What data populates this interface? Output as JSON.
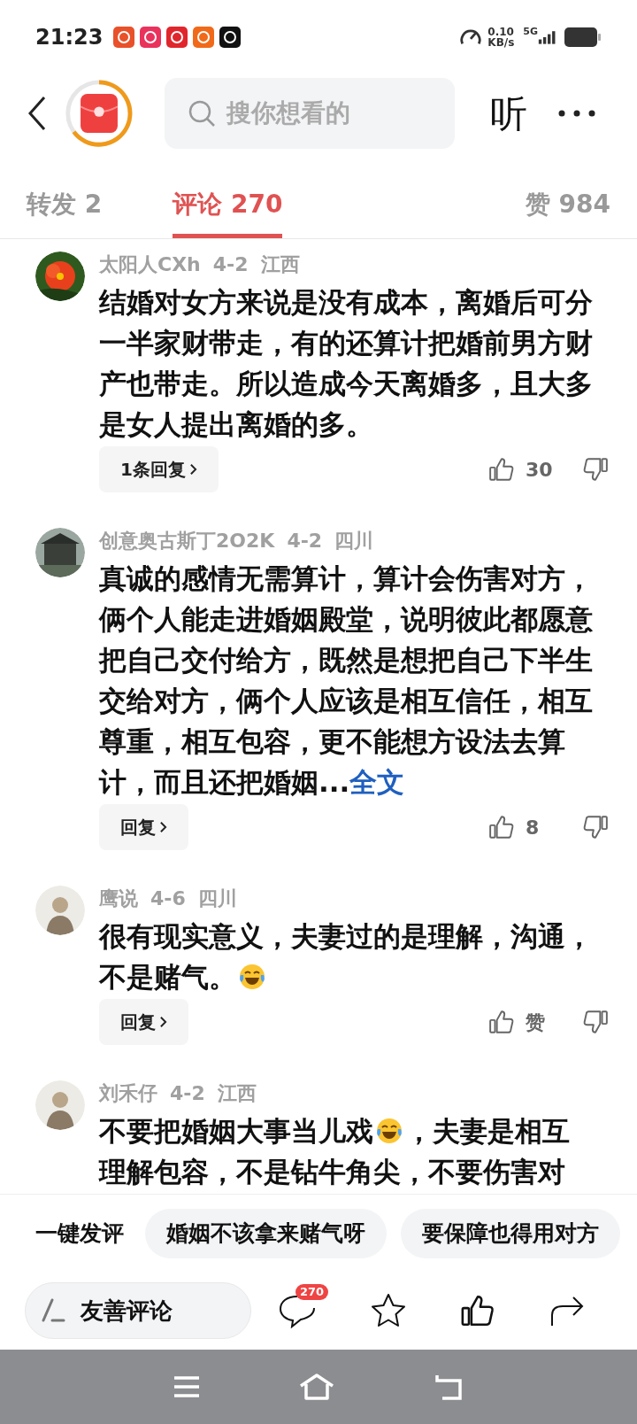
{
  "status_bar": {
    "time": "21:23",
    "speed": "0.10",
    "speed_unit": "KB/s",
    "network": "5G"
  },
  "header": {
    "search": {
      "placeholder": "搜你想看的"
    },
    "listen": "听"
  },
  "tabs": [
    {
      "label": "转发 2",
      "selected": false
    },
    {
      "label": "评论 270",
      "selected": true
    },
    {
      "label": "赞 984",
      "selected": false
    }
  ],
  "comments": [
    {
      "author": "太阳人CXh",
      "date": "4-2",
      "region": "江西",
      "content": [
        {
          "kind": "text",
          "text": "结婚对女方来说是没有成本，离婚后可分一半家财带走，有的还算计把婚前男方财产也带走。所以造成今天离婚多，且大多是女人提出离婚的多。"
        }
      ],
      "reply_label": "1条回复",
      "likes": "30"
    },
    {
      "author": "创意奥古斯丁2O2K",
      "date": "4-2",
      "region": "四川",
      "content": [
        {
          "kind": "text",
          "text": "真诚的感情无需算计，算计会伤害对方，俩个人能走进婚姻殿堂，说明彼此都愿意把自己交付给方，既然是想把自己下半生交给对方，俩个人应该是相互信任，相互尊重，相互包容，更不能想方设法去算计，而且还把婚姻..."
        },
        {
          "kind": "link",
          "text": "全文"
        }
      ],
      "reply_label": "回复",
      "likes": "8"
    },
    {
      "author": "鹰说",
      "date": "4-6",
      "region": "四川",
      "content": [
        {
          "kind": "text",
          "text": "很有现实意义，夫妻过的是理解，沟通，不是赌气。"
        },
        {
          "kind": "emoji"
        }
      ],
      "reply_label": "回复",
      "likes": "赞"
    },
    {
      "author": "刘禾仔",
      "date": "4-2",
      "region": "江西",
      "content": [
        {
          "kind": "text",
          "text": "不要把婚姻大事当儿戏"
        },
        {
          "kind": "emoji"
        },
        {
          "kind": "text",
          "text": "，夫妻是相互理解包容，不是钻牛角尖，不要伤害对"
        }
      ]
    }
  ],
  "quick_comment": {
    "label": "一键发评",
    "chips": [
      "婚姻不该拿来赌气呀",
      "要保障也得用对方"
    ]
  },
  "action_bar": {
    "input_placeholder": "友善评论",
    "comment_count": "270"
  }
}
